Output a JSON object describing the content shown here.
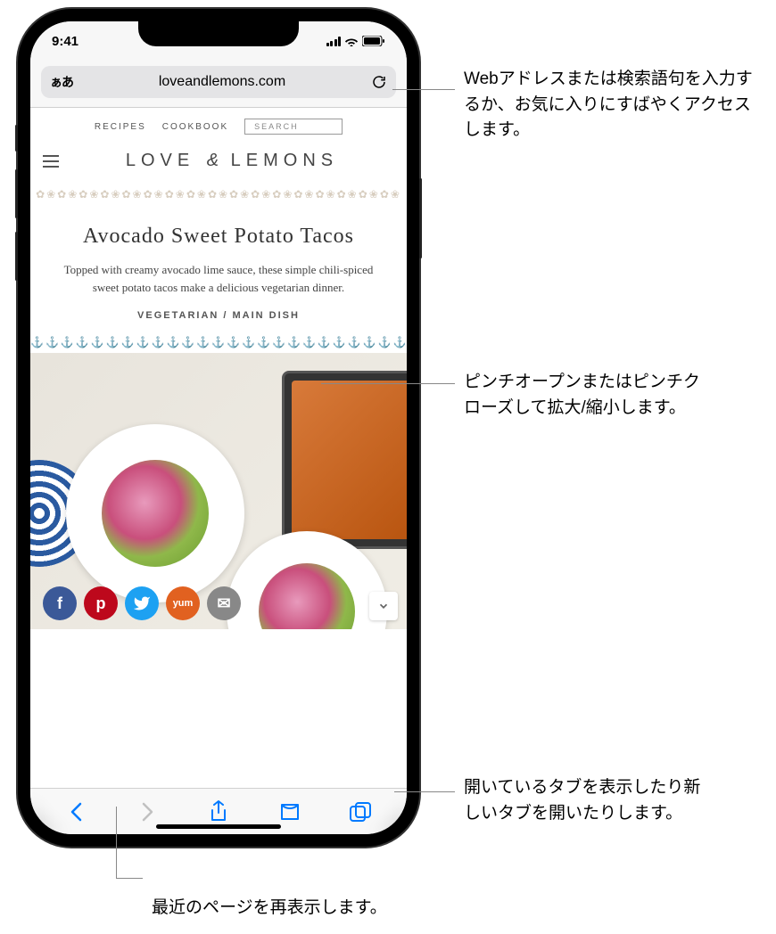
{
  "status": {
    "time": "9:41"
  },
  "urlbar": {
    "aa_label": "ぁあ",
    "url": "loveandlemons.com"
  },
  "site": {
    "nav": {
      "recipes": "RECIPES",
      "cookbook": "COOKBOOK",
      "search": "SEARCH"
    },
    "title_left": "LOVE",
    "title_amp": "&",
    "title_right": "LEMONS",
    "article_title": "Avocado Sweet Potato Tacos",
    "article_desc": "Topped with creamy avocado lime sauce, these simple chili-spiced sweet potato tacos make a delicious vegetarian dinner.",
    "tags": "VEGETARIAN / MAIN DISH",
    "share": {
      "fb": "f",
      "pn": "p",
      "tw": "t",
      "ym": "yum",
      "em": "✉"
    }
  },
  "callouts": {
    "c1": "Webアドレスまたは検索語句を入力するか、お気に入りにすばやくアクセスします。",
    "c2": "ピンチオープンまたはピンチクローズして拡大/縮小します。",
    "c3": "開いているタブを表示したり新しいタブを開いたりします。",
    "c4": "最近のページを再表示します。"
  }
}
